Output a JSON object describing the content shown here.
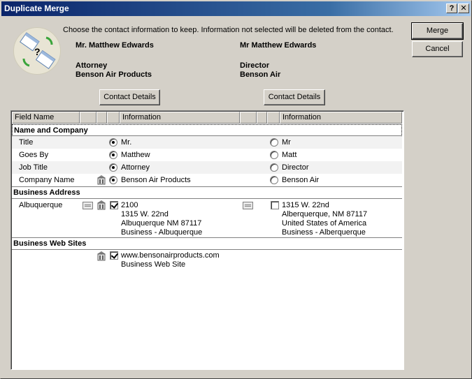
{
  "window": {
    "title": "Duplicate Merge",
    "help_label": "?",
    "close_label": "✕"
  },
  "instructions": "Choose the contact information to keep. Information not selected will be deleted from the contact.",
  "left_contact": {
    "name": "Mr. Matthew Edwards",
    "title": "Attorney",
    "company": "Benson Air Products",
    "details_label": "Contact Details"
  },
  "right_contact": {
    "name": "Mr Matthew Edwards",
    "title": "Director",
    "company": "Benson Air",
    "details_label": "Contact Details"
  },
  "buttons": {
    "merge": "Merge",
    "cancel": "Cancel"
  },
  "grid": {
    "headers": {
      "field_name": "Field Name",
      "info_left": "Information",
      "info_right": "Information"
    },
    "sections": {
      "name_company": "Name and Company",
      "business_address": "Business Address",
      "web_sites": "Business Web Sites"
    },
    "name_rows": [
      {
        "field": "Title",
        "left": "Mr.",
        "right": "Mr",
        "left_selected": true
      },
      {
        "field": "Goes By",
        "left": "Matthew",
        "right": "Matt",
        "left_selected": true
      },
      {
        "field": "Job Title",
        "left": "Attorney",
        "right": "Director",
        "left_selected": true
      },
      {
        "field": "Company Name",
        "left": "Benson Air Products",
        "right": "Benson Air",
        "left_selected": true
      }
    ],
    "address": {
      "field": "Albuquerque",
      "left": [
        "2100",
        "1315 W. 22nd",
        "Albuquerque NM 87117",
        "Business - Albuquerque"
      ],
      "right": [
        "1315 W. 22nd",
        "Alberquerque, NM 87117",
        "United States of America",
        "Business - Alberquerque"
      ],
      "left_checked": true,
      "right_checked": false
    },
    "web": {
      "left": [
        "www.bensonairproducts.com",
        "Business Web Site"
      ],
      "left_checked": true
    }
  },
  "colors": {
    "title_bar": "#0a246a",
    "face": "#d4d0c8"
  }
}
